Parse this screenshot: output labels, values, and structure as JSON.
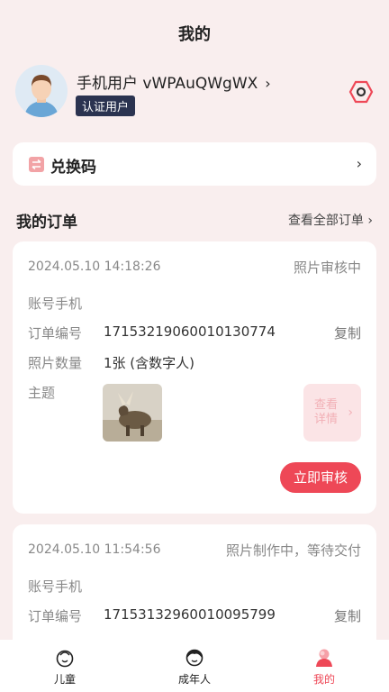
{
  "header": {
    "title": "我的"
  },
  "profile": {
    "username": "手机用户 vWPAuQWgWX",
    "badge": "认证用户",
    "chevron": "›",
    "avatar_icon": "user-avatar",
    "settings_icon": "settings-hexagon-icon"
  },
  "redeem": {
    "label": "兑换码",
    "chevron": "›",
    "icon": "exchange-icon"
  },
  "orders_section": {
    "title": "我的订单",
    "view_all": "查看全部订单 ›"
  },
  "orders": [
    {
      "timestamp": "2024.05.10 14:18:26",
      "status": "照片审核中",
      "account_label": "账号手机",
      "account_value": "",
      "order_no_label": "订单编号",
      "order_no": "17153219060010130774",
      "copy_label": "复制",
      "photo_count_label": "照片数量",
      "photo_count": "1张 (含数字人)",
      "theme_label": "主题",
      "detail_label": "查看详情",
      "action_label": "立即审核"
    },
    {
      "timestamp": "2024.05.10 11:54:56",
      "status": "照片制作中，等待交付",
      "account_label": "账号手机",
      "order_no_label": "订单编号",
      "order_no": "17153132960010095799",
      "copy_label": "复制"
    }
  ],
  "tabbar": [
    {
      "label": "儿童",
      "icon": "child-face-icon",
      "active": false
    },
    {
      "label": "成年人",
      "icon": "adult-face-icon",
      "active": false
    },
    {
      "label": "我的",
      "icon": "profile-icon",
      "active": true
    }
  ],
  "colors": {
    "accent": "#ee4857",
    "background": "#f9eeee",
    "badge_bg": "#2b3350"
  }
}
